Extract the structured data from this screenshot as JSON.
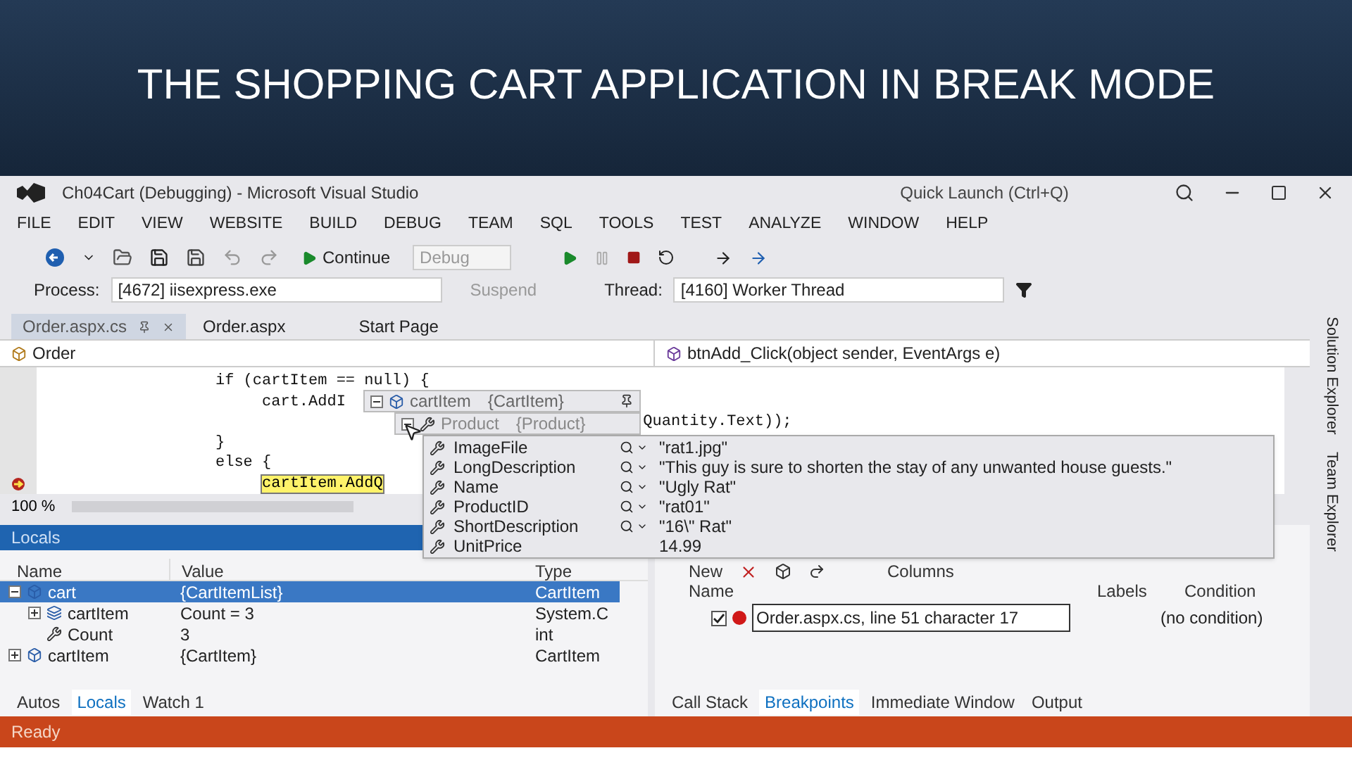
{
  "slide_title": "THE SHOPPING CART APPLICATION IN BREAK MODE",
  "window": {
    "title": "Ch04Cart (Debugging) - Microsoft Visual Studio",
    "quick_launch": {
      "placeholder": "Quick Launch (Ctrl+Q)"
    }
  },
  "menu": [
    "FILE",
    "EDIT",
    "VIEW",
    "WEBSITE",
    "BUILD",
    "DEBUG",
    "TEAM",
    "SQL",
    "TOOLS",
    "TEST",
    "ANALYZE",
    "WINDOW",
    "HELP"
  ],
  "toolbar": {
    "continue_label": "Continue",
    "configuration": "Debug"
  },
  "debug_location": {
    "process_label": "Process:",
    "process": "[4672] iisexpress.exe",
    "suspend_label": "Suspend",
    "thread_label": "Thread:",
    "thread": "[4160] Worker Thread"
  },
  "document_tabs": [
    {
      "label": "Order.aspx.cs",
      "selected": true
    },
    {
      "label": "Order.aspx",
      "selected": false
    },
    {
      "label": "Start Page",
      "selected": false
    }
  ],
  "navigation": {
    "type": "Order",
    "member": "btnAdd_Click(object sender, EventArgs e)"
  },
  "code_lines": [
    {
      "text": "if (cartItem == null) {",
      "current": false,
      "breakpoint": false
    },
    {
      "text": "     cart.AddI",
      "current": false,
      "breakpoint": false
    },
    {
      "text": "                                              Quantity.Text));",
      "current": false,
      "breakpoint": false
    },
    {
      "text": "}",
      "current": false,
      "breakpoint": false
    },
    {
      "text": "else {",
      "current": false,
      "breakpoint": false
    },
    {
      "text": "     cartItem.AddQ",
      "current": true,
      "breakpoint": true
    }
  ],
  "zoom": "100 %",
  "data_tip": {
    "object": {
      "name": "cartItem",
      "value": "{CartItem}",
      "expanded": true
    },
    "child": {
      "name": "Product",
      "value": "{Product}",
      "expanded": true
    },
    "members": [
      {
        "name": "ImageFile",
        "value": "\"rat1.jpg\"",
        "visualizer": true
      },
      {
        "name": "LongDescription",
        "value": "\"This guy is sure to shorten the stay of any unwanted house guests.\"",
        "visualizer": true
      },
      {
        "name": "Name",
        "value": "\"Ugly Rat\"",
        "visualizer": true
      },
      {
        "name": "ProductID",
        "value": "\"rat01\"",
        "visualizer": true
      },
      {
        "name": "ShortDescription",
        "value": "\"16\\\" Rat\"",
        "visualizer": true
      },
      {
        "name": "UnitPrice",
        "value": "14.99",
        "visualizer": false
      }
    ]
  },
  "side_tabs": [
    "Solution Explorer",
    "Team Explorer"
  ],
  "locals": {
    "title": "Locals",
    "columns": [
      "Name",
      "Value",
      "Type"
    ],
    "rows": [
      {
        "kind": "object",
        "name": "cart",
        "value": "{CartItemList}",
        "type": "CartItem",
        "selected": true,
        "expanded": true,
        "children": [
          {
            "kind": "collection",
            "name": "cartItem",
            "value": "Count = 3",
            "type": "System.C",
            "selected": false,
            "expanded": false
          },
          {
            "kind": "property",
            "name": "Count",
            "value": "3",
            "type": "int",
            "selected": false
          }
        ]
      },
      {
        "kind": "object",
        "name": "cartItem",
        "value": "{CartItem}",
        "type": "CartItem",
        "selected": false,
        "expanded": false
      }
    ],
    "tabs": [
      {
        "label": "Autos",
        "selected": false
      },
      {
        "label": "Locals",
        "selected": true
      },
      {
        "label": "Watch 1",
        "selected": false
      }
    ]
  },
  "breakpoints": {
    "new_label": "New",
    "columns_label": "Columns",
    "columns": [
      "Name",
      "Labels",
      "Condition"
    ],
    "rows": [
      {
        "enabled": true,
        "name": "Order.aspx.cs, line 51 character 17",
        "condition": "(no condition)"
      }
    ],
    "tabs": [
      {
        "label": "Call Stack",
        "selected": false
      },
      {
        "label": "Breakpoints",
        "selected": true
      },
      {
        "label": "Immediate Window",
        "selected": false
      },
      {
        "label": "Output",
        "selected": false
      }
    ]
  },
  "status_bar": "Ready"
}
